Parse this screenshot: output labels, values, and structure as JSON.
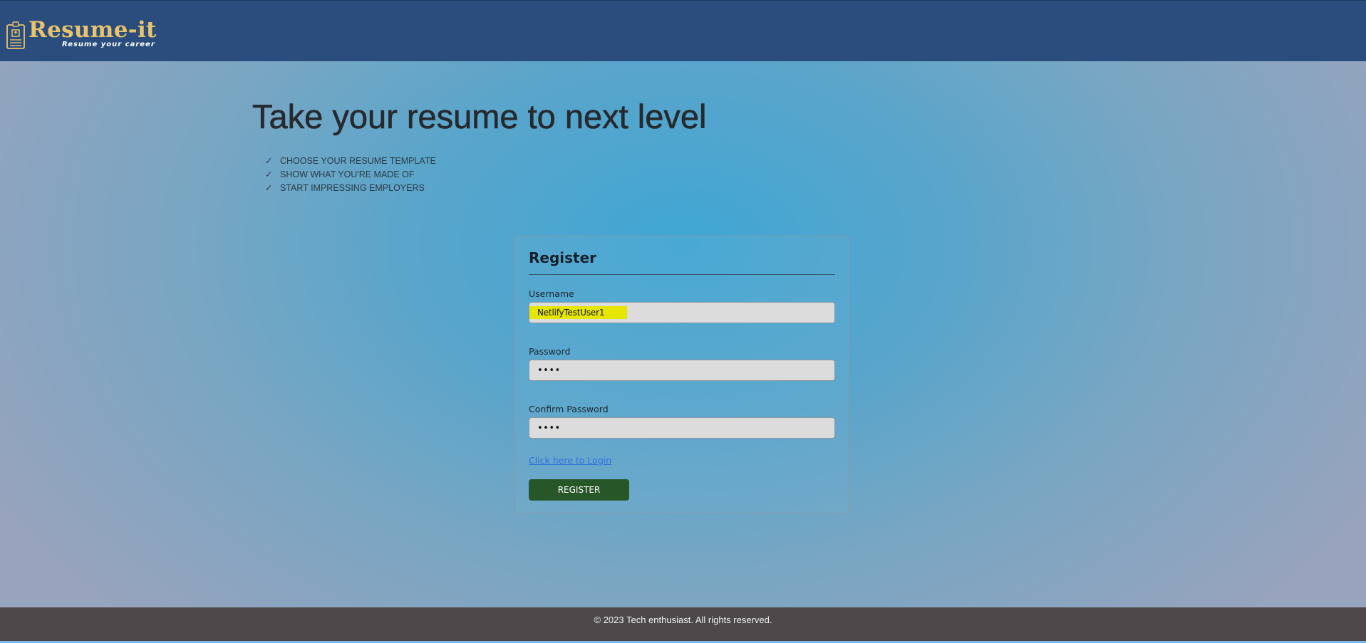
{
  "header": {
    "logo_title": "Resume-it",
    "logo_tagline": "Resume your career",
    "background_color": "#2a4d7e",
    "logo_color": "#e8c36b",
    "logo_icon": "resume-clipboard-icon"
  },
  "hero": {
    "title": "Take your resume to next level",
    "features": [
      {
        "check": "✓",
        "label": "CHOOSE YOUR RESUME TEMPLATE"
      },
      {
        "check": "✓",
        "label": "SHOW WHAT YOU'RE MADE OF"
      },
      {
        "check": "✓",
        "label": "START IMPRESSING EMPLOYERS"
      }
    ]
  },
  "register_form": {
    "title": "Register",
    "username": {
      "label": "Username",
      "value": "NetlifyTestUser1",
      "highlight_color": "#e6e600"
    },
    "password": {
      "label": "Password",
      "value": "••••"
    },
    "confirm_password": {
      "label": "Confirm Password",
      "value": "••••"
    },
    "login_link": "Click here to Login",
    "submit_label": "REGISTER",
    "submit_color": "#275729"
  },
  "footer": {
    "text": "© 2023 Tech enthusiast. All rights reserved.",
    "background_color": "#4d4849"
  }
}
